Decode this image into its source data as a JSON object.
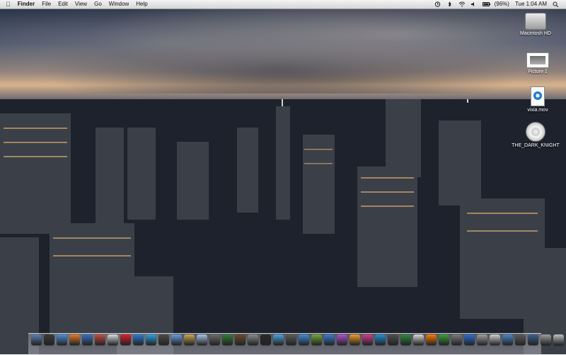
{
  "menubar": {
    "app": "Finder",
    "menus": [
      "File",
      "Edit",
      "View",
      "Go",
      "Window",
      "Help"
    ],
    "battery": "(96%)",
    "clock": "Tue 1:04 AM"
  },
  "desktop": {
    "icons": [
      {
        "label": "Macintosh HD"
      },
      {
        "label": "Picture 1"
      },
      {
        "label": "vixia.mov"
      },
      {
        "label": "THE_DARK_KNIGHT"
      }
    ]
  },
  "dock": {
    "icon_colors": [
      "#5b7fb5",
      "#3a3a3a",
      "#4b8fd4",
      "#e47b2a",
      "#3b6fbf",
      "#c74b3f",
      "#dcdcdc",
      "#dd1f2a",
      "#2c7ad6",
      "#2aa2de",
      "#4a4a4a",
      "#6a9be0",
      "#c9a64f",
      "#a7c4e7",
      "#6b6b6b",
      "#2f7d32",
      "#6b4a2f",
      "#8a8a8a",
      "#2b2b2b",
      "#4aa3e0",
      "#5b5b5b",
      "#3f8fd2",
      "#6fa83c",
      "#3a7bd5",
      "#b14fd1",
      "#f29a2a",
      "#d33c8f",
      "#1f8fd6",
      "#4e4e4e",
      "#2d8a3e",
      "#d8d8d8",
      "#ff7a00",
      "#3d9e3d",
      "#7a7a7a",
      "#2e6fd1",
      "#a0a0a0",
      "#cfcfcf",
      "#4a86c7",
      "#5c5c5c",
      "#3d5f8f",
      "#9d9d9d",
      "#bdbdbd",
      "#3b3b3b",
      "#7da0d6"
    ]
  }
}
